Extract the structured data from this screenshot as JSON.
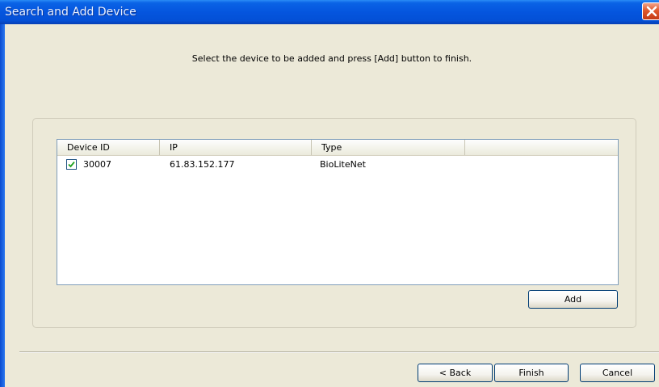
{
  "window": {
    "title": "Search and Add Device",
    "close_icon": "close-icon"
  },
  "instruction": "Select the device to be added and press [Add] button to finish.",
  "device_list": {
    "columns": [
      "Device ID",
      "IP",
      "Type",
      ""
    ],
    "rows": [
      {
        "checked": true,
        "device_id": "30007",
        "ip": "61.83.152.177",
        "type": "BioLiteNet"
      }
    ]
  },
  "buttons": {
    "add": "Add",
    "back": "< Back",
    "finish": "Finish",
    "cancel": "Cancel"
  },
  "colors": {
    "titlebar": "#0555de",
    "dialog_bg": "#ece9d8",
    "check_mark": "#21a121",
    "close_button": "#e0582c"
  }
}
